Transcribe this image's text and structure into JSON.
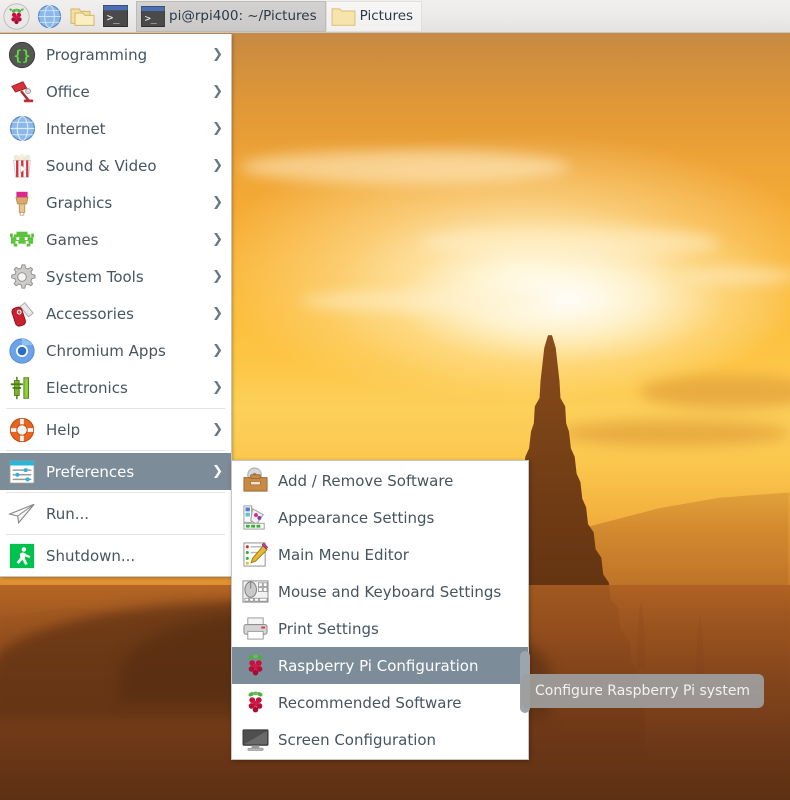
{
  "desktop": {
    "wallpaper_name": "bagan-temple-sunset",
    "wallpaper_colors": {
      "sky_top": "#b98448",
      "sky_mid": "#fbb937",
      "sun_glow": "#fffaf0",
      "ground": "#7c4019"
    }
  },
  "taskbar": {
    "background": "#ebeae9",
    "launchers": [
      {
        "name": "raspberry-menu-icon",
        "label": "Menu"
      },
      {
        "name": "web-browser-icon",
        "label": "Web Browser"
      },
      {
        "name": "file-manager-icon",
        "label": "File Manager"
      },
      {
        "name": "terminal-icon",
        "label": "Terminal"
      }
    ],
    "windows": [
      {
        "name": "window-button-terminal",
        "label": "pi@rpi400: ~/Pictures",
        "icon": "terminal-icon",
        "state": "active"
      },
      {
        "name": "window-button-pictures",
        "label": "Pictures",
        "icon": "folder-icon",
        "state": "inactive"
      }
    ]
  },
  "main_menu": {
    "selected": "Preferences",
    "highlight_color": "#7d8c99",
    "items": [
      {
        "label": "Programming",
        "icon": "code-braces-icon",
        "submenu": true
      },
      {
        "label": "Office",
        "icon": "desk-lamp-icon",
        "submenu": true
      },
      {
        "label": "Internet",
        "icon": "globe-icon",
        "submenu": true
      },
      {
        "label": "Sound & Video",
        "icon": "popcorn-video-icon",
        "submenu": true
      },
      {
        "label": "Graphics",
        "icon": "paintbrush-icon",
        "submenu": true
      },
      {
        "label": "Games",
        "icon": "space-invader-icon",
        "submenu": true
      },
      {
        "label": "System Tools",
        "icon": "gear-icon",
        "submenu": true
      },
      {
        "label": "Accessories",
        "icon": "swiss-knife-icon",
        "submenu": true
      },
      {
        "label": "Chromium Apps",
        "icon": "chromium-icon",
        "submenu": true
      },
      {
        "label": "Electronics",
        "icon": "circuit-icon",
        "submenu": true
      },
      {
        "separator": true
      },
      {
        "label": "Help",
        "icon": "life-ring-icon",
        "submenu": true
      },
      {
        "separator": true
      },
      {
        "label": "Preferences",
        "icon": "sliders-icon",
        "submenu": true,
        "selected": true
      },
      {
        "separator": true
      },
      {
        "label": "Run...",
        "icon": "paper-plane-icon",
        "submenu": false
      },
      {
        "separator": true
      },
      {
        "label": "Shutdown...",
        "icon": "exit-runner-icon",
        "submenu": false
      }
    ]
  },
  "sub_menu": {
    "parent": "Preferences",
    "selected": "Raspberry Pi Configuration",
    "highlight_color": "#7d8c99",
    "items": [
      {
        "label": "Add / Remove Software",
        "icon": "software-briefcase-icon"
      },
      {
        "label": "Appearance Settings",
        "icon": "appearance-palette-icon"
      },
      {
        "label": "Main Menu Editor",
        "icon": "menu-editor-pencil-icon"
      },
      {
        "label": "Mouse and Keyboard Settings",
        "icon": "mouse-keyboard-icon"
      },
      {
        "label": "Print Settings",
        "icon": "printer-icon"
      },
      {
        "label": "Raspberry Pi Configuration",
        "icon": "raspberry-icon",
        "selected": true
      },
      {
        "label": "Recommended Software",
        "icon": "raspberry-icon"
      },
      {
        "label": "Screen Configuration",
        "icon": "monitor-icon"
      }
    ],
    "scrollbar_visible": true
  },
  "tooltip": {
    "text": "Configure Raspberry Pi system",
    "background": "#9e9e9e"
  }
}
